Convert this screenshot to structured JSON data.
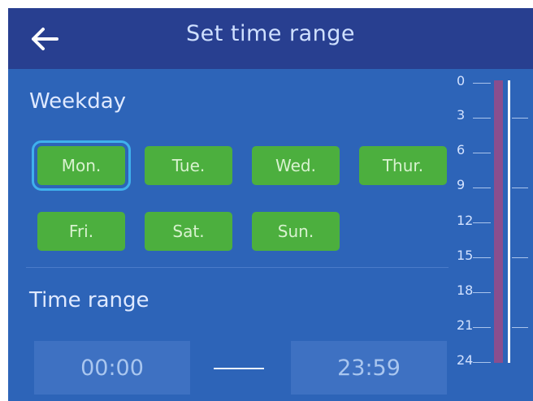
{
  "header": {
    "title": "Set time range",
    "back_icon": "arrow-left-icon"
  },
  "weekday": {
    "label": "Weekday",
    "days": [
      "Mon.",
      "Tue.",
      "Wed.",
      "Thur.",
      "Fri.",
      "Sat.",
      "Sun."
    ],
    "selected": "Mon."
  },
  "time_range": {
    "label": "Time range",
    "start": "00:00",
    "end": "23:59"
  },
  "scale": {
    "labels": [
      "0",
      "3",
      "6",
      "9",
      "12",
      "15",
      "18",
      "21",
      "24"
    ]
  },
  "colors": {
    "background": "#2d64b8",
    "header": "#283f90",
    "day_button": "#4caf3e",
    "selected_outline": "#3fb1ec",
    "range_bar": "#8a4e8e"
  }
}
